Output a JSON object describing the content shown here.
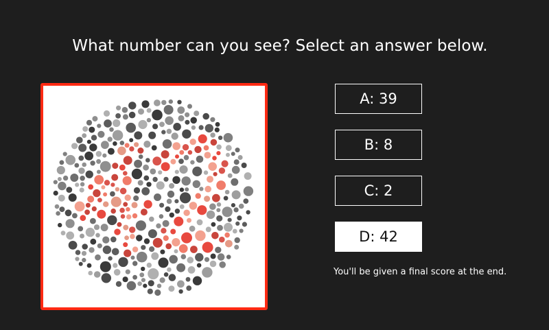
{
  "question": "What number can you see? Select an answer below.",
  "plate": {
    "description_icon": "ishihara-color-plate-icon",
    "colors": {
      "frame": "#ff2a13",
      "figure": [
        "#e8493f",
        "#d9544c",
        "#f07c6a",
        "#e59a86",
        "#c9453c",
        "#f3a18f"
      ],
      "background": [
        "#3a3a3a",
        "#4a4a4a",
        "#5c5c5c",
        "#6e6e6e",
        "#808080",
        "#8f8f8f",
        "#9e9e9e",
        "#b0b0b0"
      ]
    }
  },
  "answers": [
    {
      "id": "A",
      "label": "A: 39",
      "selected": false
    },
    {
      "id": "B",
      "label": "B: 8",
      "selected": false
    },
    {
      "id": "C",
      "label": "C: 2",
      "selected": false
    },
    {
      "id": "D",
      "label": "D: 42",
      "selected": true
    }
  ],
  "footnote": "You'll be given a final score at the end."
}
